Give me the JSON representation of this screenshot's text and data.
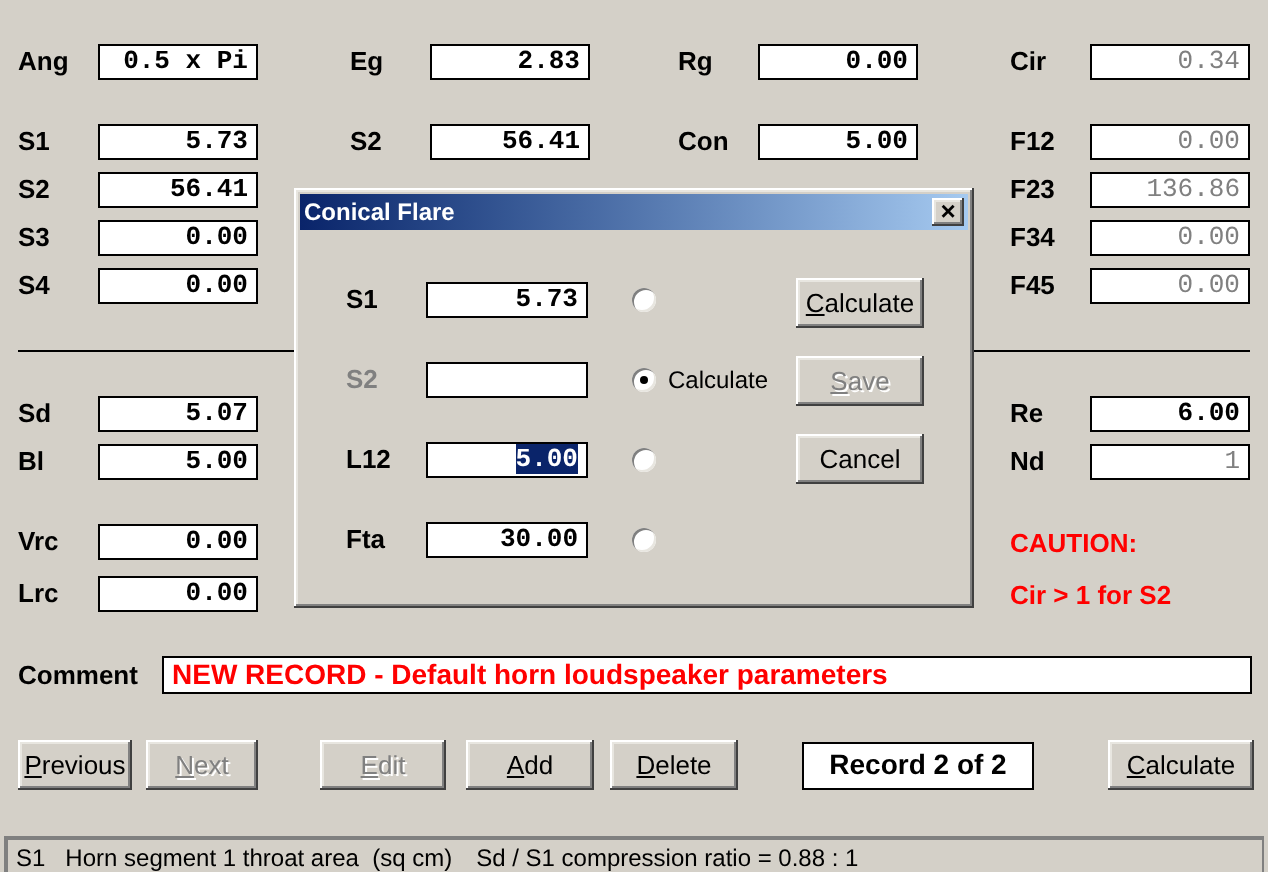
{
  "top_rows": [
    [
      {
        "label": "Ang",
        "value": "0.5 x Pi",
        "disabled": false
      },
      {
        "label": "Eg",
        "value": "2.83",
        "disabled": false
      },
      {
        "label": "Rg",
        "value": "0.00",
        "disabled": false
      },
      {
        "label": "Cir",
        "value": "0.34",
        "disabled": true
      }
    ],
    [
      {
        "label": "S1",
        "value": "5.73",
        "disabled": false
      },
      {
        "label": "S2",
        "value": "56.41",
        "disabled": false
      },
      {
        "label": "Con",
        "value": "5.00",
        "disabled": false
      },
      {
        "label": "F12",
        "value": "0.00",
        "disabled": true
      }
    ],
    [
      {
        "label": "S2",
        "value": "56.41",
        "disabled": false
      },
      null,
      null,
      {
        "label": "F23",
        "value": "136.86",
        "disabled": true
      }
    ],
    [
      {
        "label": "S3",
        "value": "0.00",
        "disabled": false
      },
      null,
      null,
      {
        "label": "F34",
        "value": "0.00",
        "disabled": true
      }
    ],
    [
      {
        "label": "S4",
        "value": "0.00",
        "disabled": false
      },
      null,
      null,
      {
        "label": "F45",
        "value": "0.00",
        "disabled": true
      }
    ]
  ],
  "lower_rows": [
    [
      {
        "kind": "field",
        "label": "Sd",
        "value": "5.07",
        "disabled": false
      },
      null,
      null,
      {
        "kind": "field",
        "label": "Re",
        "value": "6.00",
        "disabled": false
      }
    ],
    [
      {
        "kind": "field",
        "label": "Bl",
        "value": "5.00",
        "disabled": false
      },
      null,
      null,
      {
        "kind": "field",
        "label": "Nd",
        "value": "1",
        "disabled": true
      }
    ],
    [
      {
        "kind": "field",
        "label": "Vrc",
        "value": "0.00",
        "disabled": false
      },
      null,
      null,
      {
        "kind": "warning",
        "text": "CAUTION:"
      }
    ],
    [
      {
        "kind": "field",
        "label": "Lrc",
        "value": "0.00",
        "disabled": false
      },
      null,
      null,
      {
        "kind": "warning",
        "text": "Cir > 1 for S2"
      }
    ]
  ],
  "comment": {
    "label": "Comment",
    "value": "NEW RECORD - Default horn loudspeaker parameters"
  },
  "buttons": [
    {
      "kind": "button",
      "label": "Previous",
      "disabled": false,
      "accel": true
    },
    {
      "kind": "button",
      "label": "Next",
      "disabled": true,
      "accel": true
    },
    {
      "kind": "button",
      "label": "Edit",
      "disabled": true,
      "accel": true
    },
    {
      "kind": "button",
      "label": "Add",
      "disabled": false,
      "accel": true
    },
    {
      "kind": "button",
      "label": "Delete",
      "disabled": false,
      "accel": true
    },
    {
      "kind": "record",
      "label": "Record 2 of 2"
    },
    {
      "kind": "button",
      "label": "Calculate",
      "disabled": false,
      "accel": true
    }
  ],
  "status_bar": [
    "S1   Horn segment 1 throat area  (sq cm)",
    "Sd / S1 compression ratio = 0.88 : 1"
  ],
  "dialog": {
    "title": "Conical Flare",
    "close": "×",
    "rows": [
      {
        "label": "S1",
        "value": "5.73",
        "disabled": false,
        "highlighted": false,
        "selected": false
      },
      {
        "label": "S2",
        "disabled": true,
        "selected": true,
        "option_label": "Calculate"
      },
      {
        "label": "L12",
        "value": "5.00",
        "disabled": false,
        "highlighted": true,
        "selected": false
      },
      {
        "label": "Fta",
        "value": "30.00",
        "disabled": false,
        "highlighted": false,
        "selected": false
      }
    ],
    "buttons": [
      {
        "label": "Calculate",
        "disabled": false,
        "accel": true
      },
      {
        "label": "Save",
        "disabled": true,
        "accel": true
      },
      {
        "label": "Cancel",
        "disabled": false,
        "accel": false
      }
    ]
  }
}
